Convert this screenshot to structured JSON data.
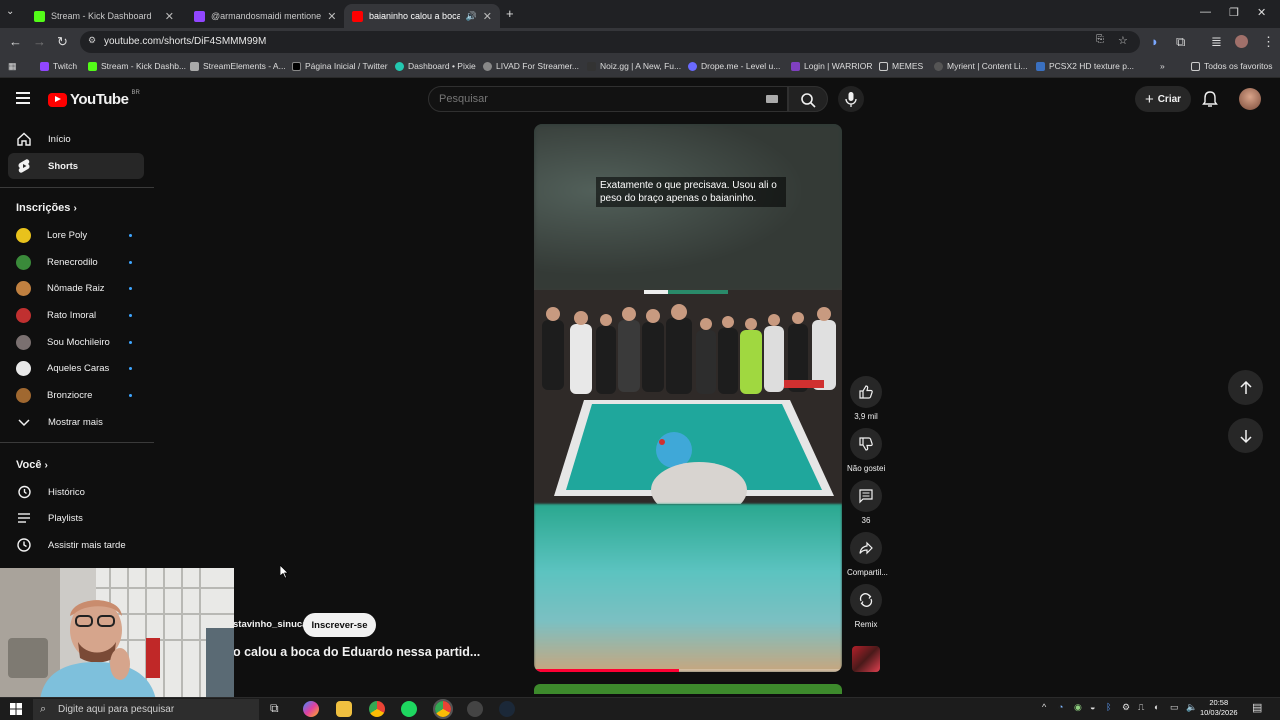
{
  "browser": {
    "tabs": [
      {
        "title": "Stream - Kick Dashboard",
        "active": false
      },
      {
        "title": "@armandosmaidi mentione",
        "active": false
      },
      {
        "title": "baianinho calou a boca do",
        "active": true
      }
    ],
    "url": "youtube.com/shorts/DiF4SMMM99M",
    "bookmarks": [
      "Twitch",
      "Stream - Kick Dashb...",
      "StreamElements - A...",
      "Página Inicial / Twitter",
      "Dashboard • Pixie",
      "LIVAD For Streamer...",
      "Noiz.gg | A New, Fu...",
      "Drope.me - Level u...",
      "Login | WARRIOR",
      "MEMES",
      "Myrient | Content Li...",
      "PCSX2 HD texture p..."
    ],
    "all_bookmarks": "Todos os favoritos"
  },
  "header": {
    "logo": "YouTube",
    "country": "BR",
    "search_placeholder": "Pesquisar",
    "create_label": "Criar"
  },
  "sidebar": {
    "main": [
      {
        "label": "Início",
        "icon": "home-icon",
        "active": false
      },
      {
        "label": "Shorts",
        "icon": "shorts-icon",
        "active": true
      }
    ],
    "subs_heading": "Inscrições",
    "subscriptions": [
      {
        "name": "Lore Poly",
        "color": "#e8c21c"
      },
      {
        "name": "Renecrodilo",
        "color": "#3a8a3a"
      },
      {
        "name": "Nômade Raiz",
        "color": "#c08040"
      },
      {
        "name": "Rato Imoral",
        "color": "#c03030"
      },
      {
        "name": "Sou Mochileiro",
        "color": "#7a7070"
      },
      {
        "name": "Aqueles Caras",
        "color": "#e8e8e8"
      },
      {
        "name": "Bronziocre",
        "color": "#a06830"
      }
    ],
    "show_more": "Mostrar mais",
    "you_heading": "Você",
    "you": [
      {
        "label": "Histórico",
        "icon": "history-icon"
      },
      {
        "label": "Playlists",
        "icon": "playlist-icon"
      },
      {
        "label": "Assistir mais tarde",
        "icon": "watch-later-icon"
      }
    ]
  },
  "short": {
    "caption": "Exatamente o que precisava. Usou ali o peso do braço apenas o baianinho.",
    "channel": "@gustavinho_sinuca",
    "channel_visible": "stavinho_sinuca",
    "subscribe": "Inscrever-se",
    "title_visible": "o calou a boca do Eduardo nessa partid...",
    "progress": 0.47
  },
  "actions": {
    "likes": "3,9 mil",
    "dislike": "Não gostei",
    "comments": "36",
    "share": "Compartil...",
    "remix": "Remix"
  },
  "taskbar": {
    "search": "Digite aqui para pesquisar",
    "time": "20:58",
    "date": "10/03/2026"
  }
}
